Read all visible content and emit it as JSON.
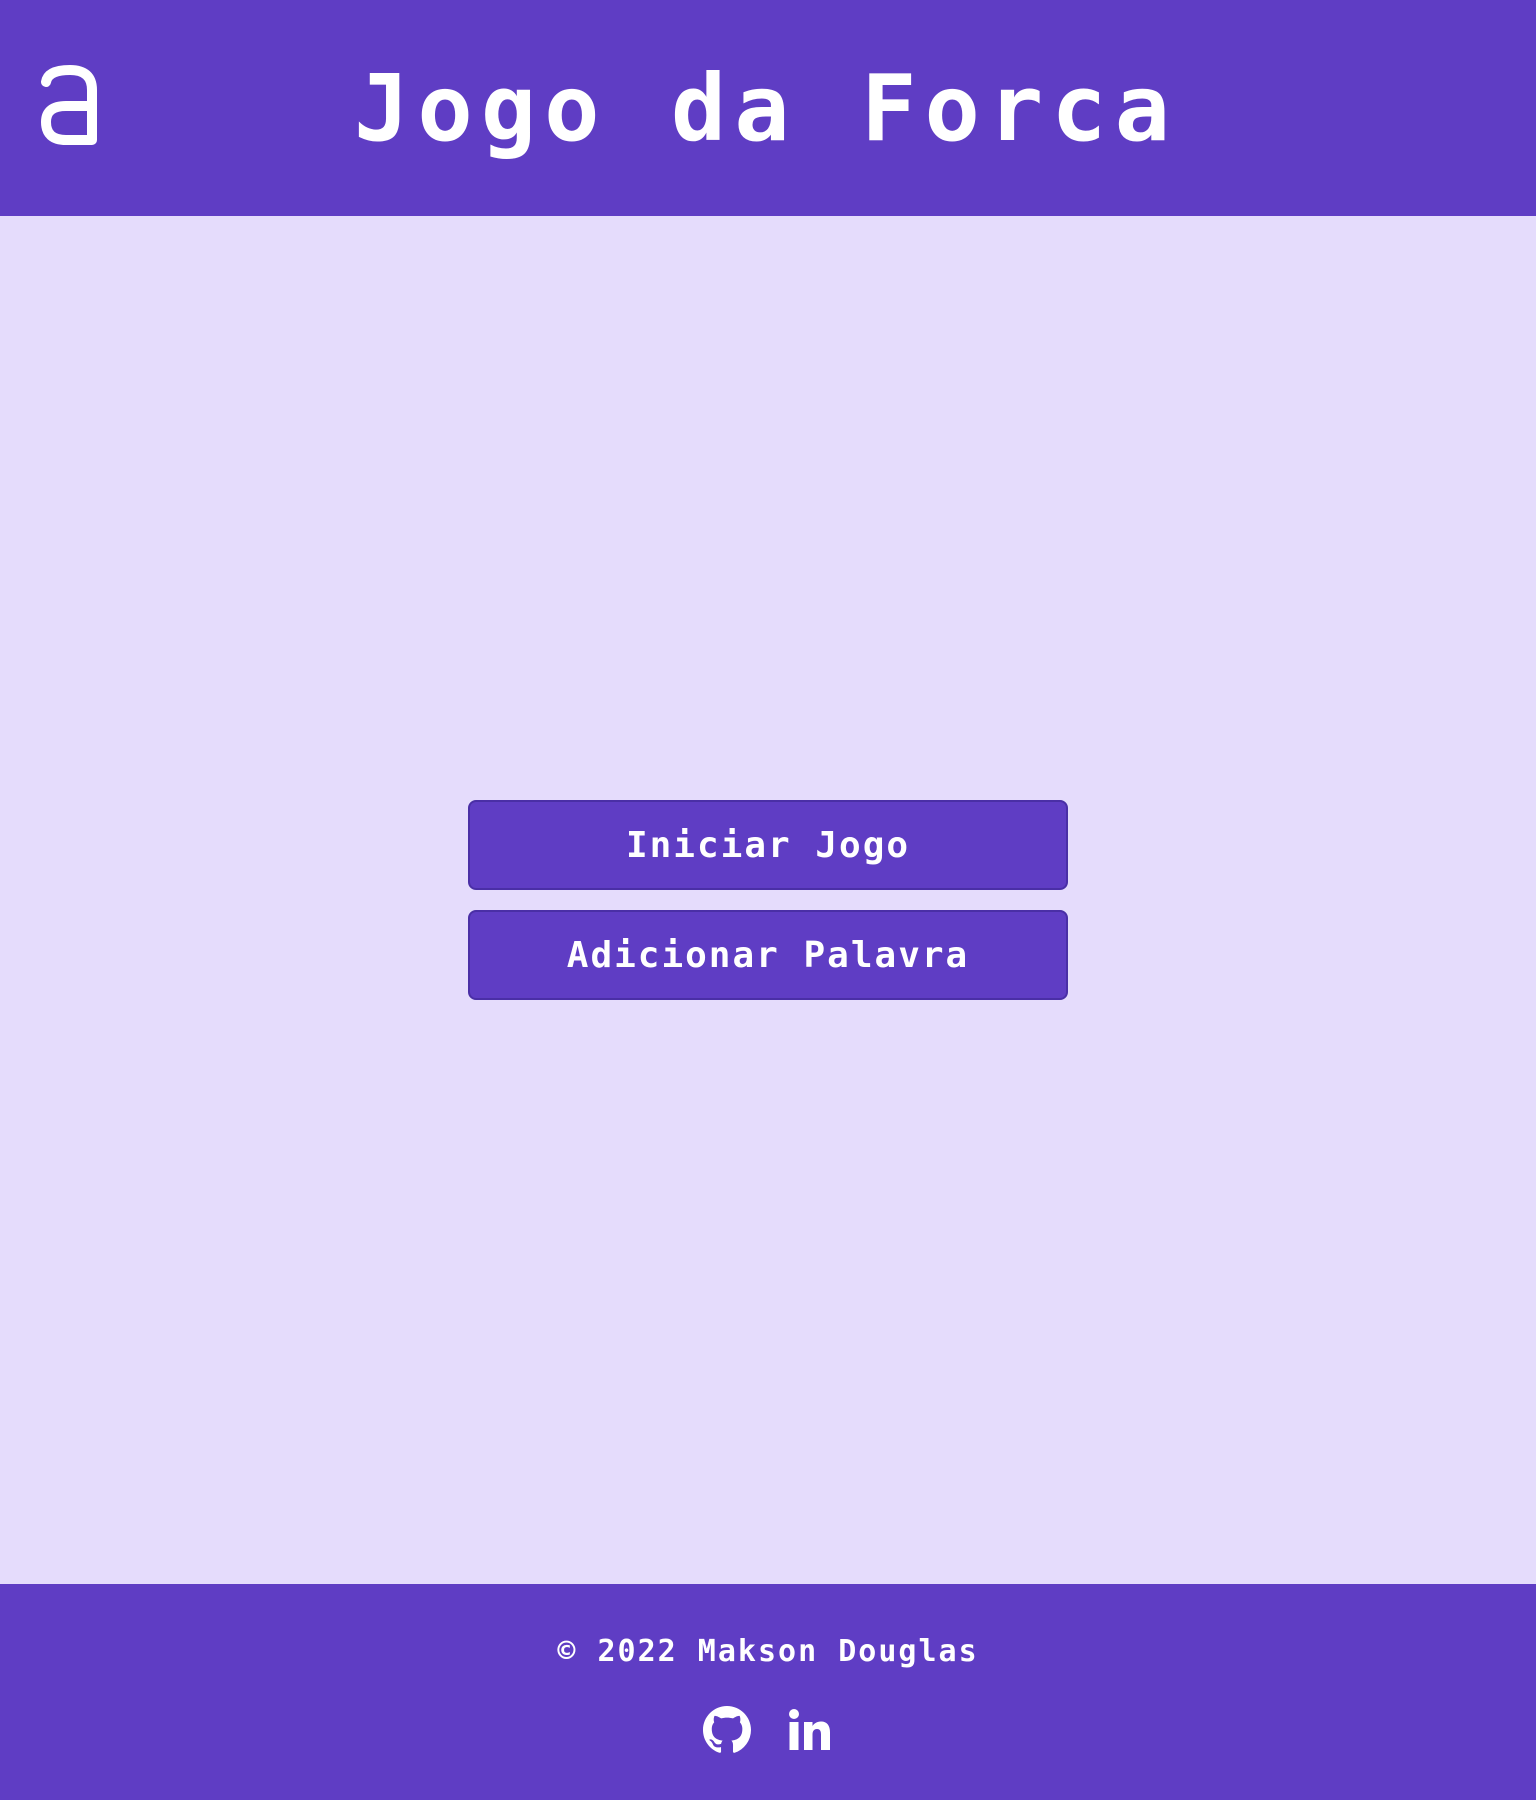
{
  "header": {
    "logo_icon": "alura-logo-icon",
    "title": "Jogo da Forca"
  },
  "main": {
    "start_button_label": "Iniciar Jogo",
    "add_word_button_label": "Adicionar Palavra"
  },
  "footer": {
    "copyright": "© 2022 Makson Douglas",
    "social_icons": [
      "github-icon",
      "linkedin-icon"
    ]
  },
  "colors": {
    "primary": "#5f3dc4",
    "background": "#e5dcfc",
    "text_on_primary": "#ffffff"
  }
}
